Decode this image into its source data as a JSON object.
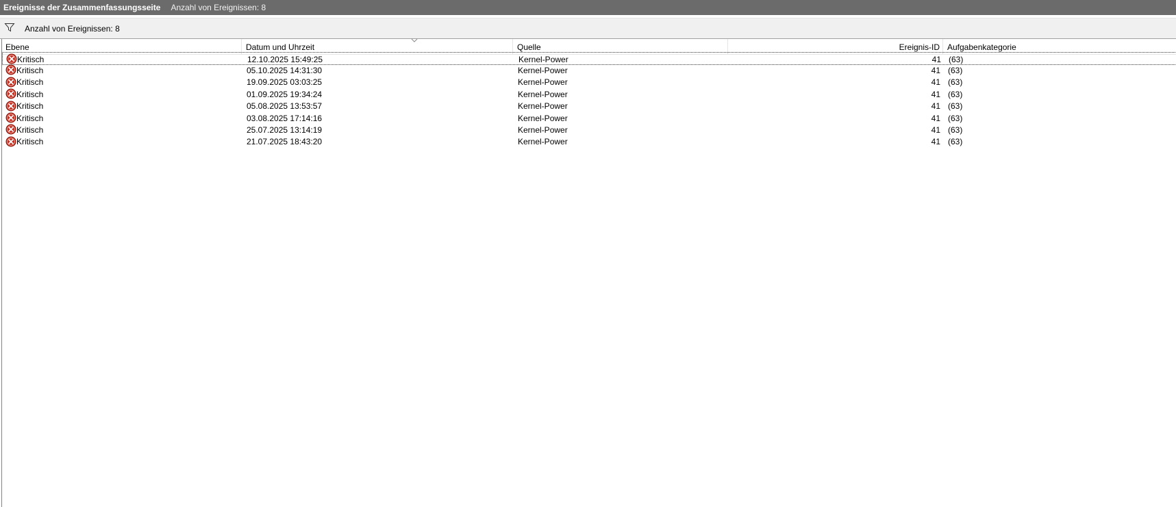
{
  "titlebar": {
    "title": "Ereignisse der Zusammenfassungsseite",
    "count": "Anzahl von Ereignissen: 8"
  },
  "filterbar": {
    "icon": "filter-icon",
    "text": "Anzahl von Ereignissen: 8"
  },
  "table": {
    "columns": [
      "Ebene",
      "Datum und Uhrzeit",
      "Quelle",
      "",
      "Ereignis-ID",
      "Aufgabenkategorie"
    ],
    "sorted_column": "Datum und Uhrzeit",
    "sort_direction": "descending",
    "rows": [
      {
        "level": "Kritisch",
        "datetime": "12.10.2025 15:49:25",
        "source": "Kernel-Power",
        "id": "41",
        "category": "(63)"
      },
      {
        "level": "Kritisch",
        "datetime": "05.10.2025 14:31:30",
        "source": "Kernel-Power",
        "id": "41",
        "category": "(63)"
      },
      {
        "level": "Kritisch",
        "datetime": "19.09.2025 03:03:25",
        "source": "Kernel-Power",
        "id": "41",
        "category": "(63)"
      },
      {
        "level": "Kritisch",
        "datetime": "01.09.2025 19:34:24",
        "source": "Kernel-Power",
        "id": "41",
        "category": "(63)"
      },
      {
        "level": "Kritisch",
        "datetime": "05.08.2025 13:53:57",
        "source": "Kernel-Power",
        "id": "41",
        "category": "(63)"
      },
      {
        "level": "Kritisch",
        "datetime": "03.08.2025 17:14:16",
        "source": "Kernel-Power",
        "id": "41",
        "category": "(63)"
      },
      {
        "level": "Kritisch",
        "datetime": "25.07.2025 13:14:19",
        "source": "Kernel-Power",
        "id": "41",
        "category": "(63)"
      },
      {
        "level": "Kritisch",
        "datetime": "21.07.2025 18:43:20",
        "source": "Kernel-Power",
        "id": "41",
        "category": "(63)"
      }
    ]
  },
  "colors": {
    "titlebar_bg": "#6b6b6b",
    "error_icon": "#c42b1c"
  }
}
